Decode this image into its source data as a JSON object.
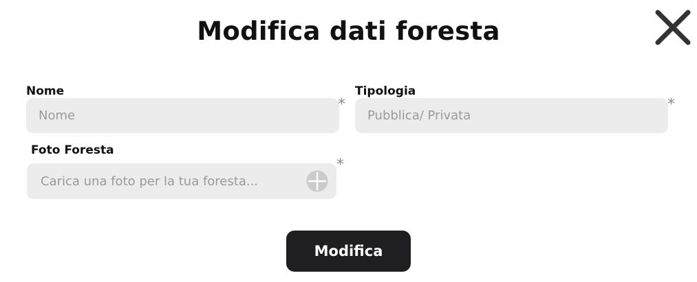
{
  "modal": {
    "title": "Modifica dati foresta",
    "close_icon": "close-icon"
  },
  "form": {
    "nome": {
      "label": "Nome",
      "placeholder": "Nome",
      "value": "",
      "required_mark": "*"
    },
    "tipologia": {
      "label": "Tipologia",
      "placeholder": "Pubblica/ Privata",
      "value": "",
      "required_mark": "*"
    },
    "foto": {
      "label": "Foto Foresta",
      "placeholder": "Carica una foto per la tua foresta...",
      "required_mark": "*",
      "add_icon": "add-circle-icon"
    }
  },
  "actions": {
    "submit_label": "Modifica"
  },
  "colors": {
    "field_background": "#ececec",
    "button_background": "#1f1f21",
    "placeholder_text": "#9a9a9a",
    "required_mark": "#8c8c8c",
    "close_icon": "#333333"
  }
}
